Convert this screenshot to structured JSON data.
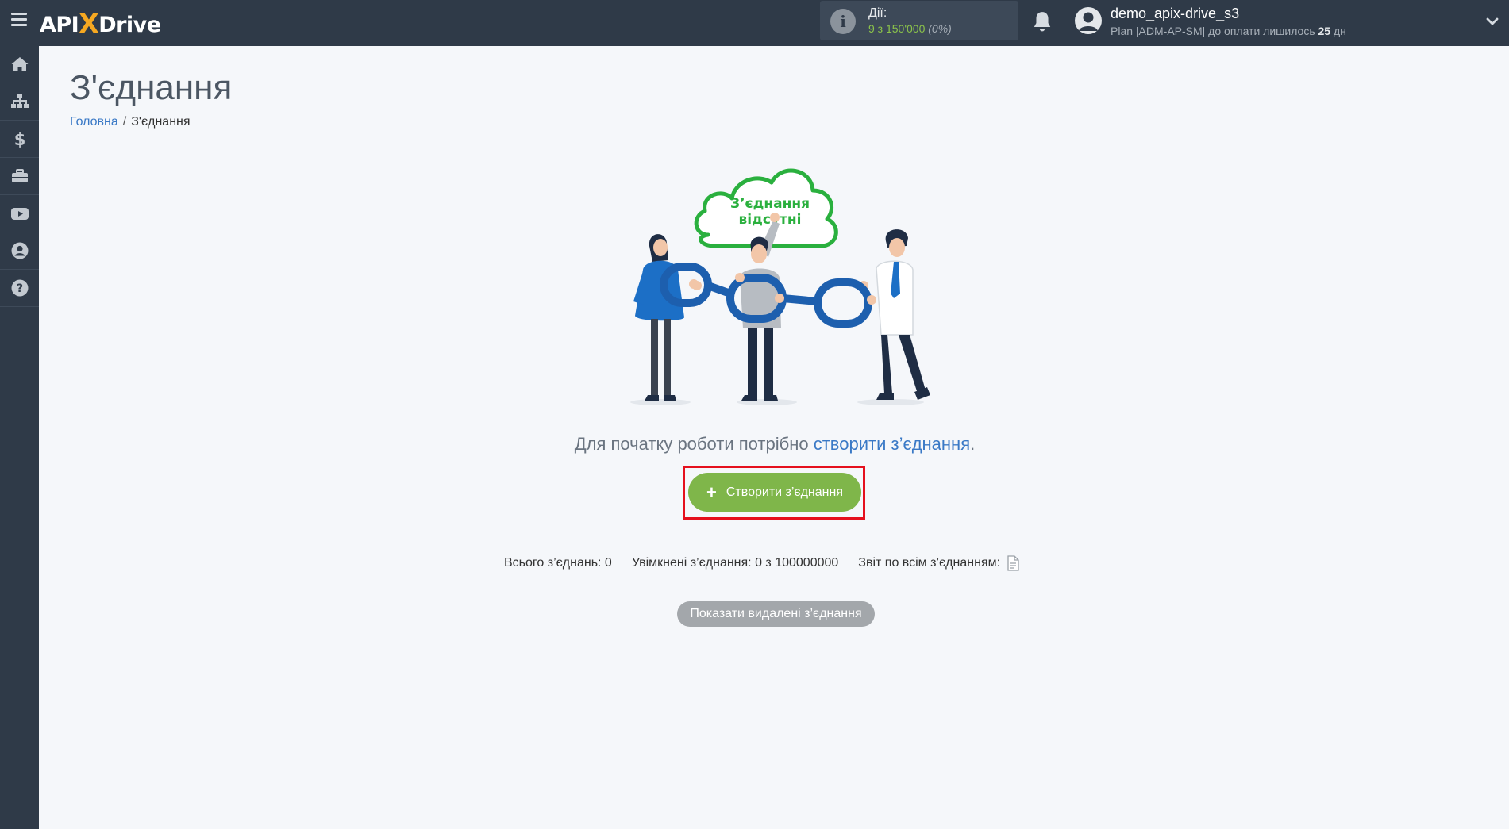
{
  "header": {
    "logo": {
      "part1": "API",
      "part2": "X",
      "part3": "Drive"
    },
    "actions": {
      "label": "Дії:",
      "value": "9 з 150'000",
      "percent": "(0%)"
    },
    "user": {
      "name": "demo_apix-drive_s3",
      "plan_prefix": "Plan |ADM-AP-SM| до оплати лишилось",
      "days": "25",
      "days_suffix": "дн"
    }
  },
  "sidebar": {
    "items": [
      {
        "icon": "home-icon"
      },
      {
        "icon": "sitemap-icon"
      },
      {
        "icon": "dollar-icon"
      },
      {
        "icon": "briefcase-icon"
      },
      {
        "icon": "youtube-icon"
      },
      {
        "icon": "user-circle-icon"
      },
      {
        "icon": "question-circle-icon"
      }
    ]
  },
  "main": {
    "title": "З'єднання",
    "breadcrumb": {
      "home": "Головна",
      "separator": "/",
      "current": "З'єднання"
    },
    "cloud_text": {
      "line1": "З’єднання",
      "line2": "відсутні"
    },
    "lead_text": "Для початку роботи потрібно",
    "lead_link": "створити з’єднання",
    "lead_end": ".",
    "create_button": "Створити з’єднання",
    "stats": {
      "total": "Всього з’єднань: 0",
      "enabled": "Увімкнені з’єднання: 0 з 100000000",
      "report": "Звіт по всім з’єднанням:"
    },
    "deleted_button": "Показати видалені з’єднання"
  },
  "colors": {
    "topbar": "#2f3a48",
    "accent_green": "#7fb64a",
    "link_blue": "#3a79c6",
    "highlight_red": "#e5101d",
    "logo_x": "#f6a821"
  }
}
